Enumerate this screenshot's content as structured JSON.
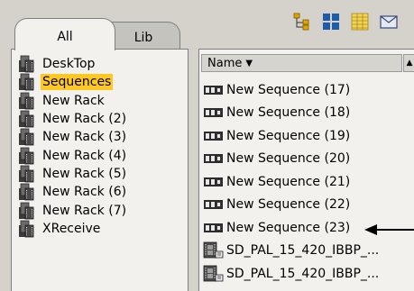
{
  "tabs": [
    {
      "label": "All",
      "active": true
    },
    {
      "label": "Lib",
      "active": false
    }
  ],
  "toolbar": {
    "icons": [
      "hierarchy-view-icon",
      "grid-view-icon",
      "list-view-icon",
      "mail-icon"
    ]
  },
  "tree": {
    "items": [
      {
        "label": "DeskTop",
        "selected": false
      },
      {
        "label": "Sequences",
        "selected": true
      },
      {
        "label": "New Rack",
        "selected": false
      },
      {
        "label": "New Rack (2)",
        "selected": false
      },
      {
        "label": "New Rack (3)",
        "selected": false
      },
      {
        "label": "New Rack (4)",
        "selected": false
      },
      {
        "label": "New Rack (5)",
        "selected": false
      },
      {
        "label": "New Rack (6)",
        "selected": false
      },
      {
        "label": "New Rack (7)",
        "selected": false
      },
      {
        "label": "XReceive",
        "selected": false
      }
    ]
  },
  "list": {
    "column_header": "Name",
    "sort_indicator": "▼",
    "items": [
      {
        "label": "New Sequence (17)",
        "icon": "sequence-icon"
      },
      {
        "label": "New Sequence (18)",
        "icon": "sequence-icon"
      },
      {
        "label": "New Sequence (19)",
        "icon": "sequence-icon"
      },
      {
        "label": "New Sequence (20)",
        "icon": "sequence-icon"
      },
      {
        "label": "New Sequence (21)",
        "icon": "sequence-icon"
      },
      {
        "label": "New Sequence (22)",
        "icon": "sequence-icon"
      },
      {
        "label": "New Sequence (23)",
        "icon": "sequence-icon"
      },
      {
        "label": "SD_PAL_15_420_IBBP_...",
        "icon": "clip-icon"
      },
      {
        "label": "SD_PAL_15_420_IBBP_...",
        "icon": "clip-icon"
      }
    ]
  },
  "colors": {
    "selection": "#ffc821",
    "panel": "#f2f1ee",
    "background": "#d4d2cb"
  }
}
